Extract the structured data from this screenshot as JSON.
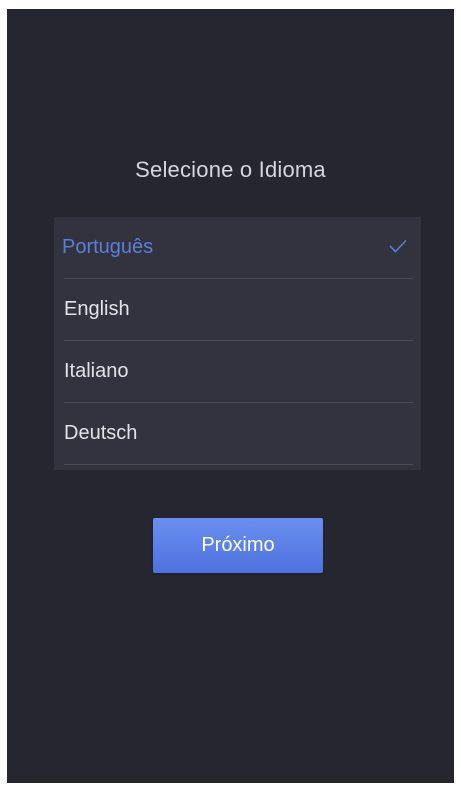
{
  "title": "Selecione o Idioma",
  "languages": [
    {
      "label": "Português",
      "selected": true
    },
    {
      "label": "English",
      "selected": false
    },
    {
      "label": "Italiano",
      "selected": false
    },
    {
      "label": "Deutsch",
      "selected": false
    }
  ],
  "selected_language": "Português",
  "next_label": "Próximo",
  "colors": {
    "background": "#262630",
    "list_background": "#33333f",
    "accent": "#5b7fd6",
    "button": "#5a7fe8"
  },
  "icons": {
    "selected_marker": "checkmark-icon"
  }
}
